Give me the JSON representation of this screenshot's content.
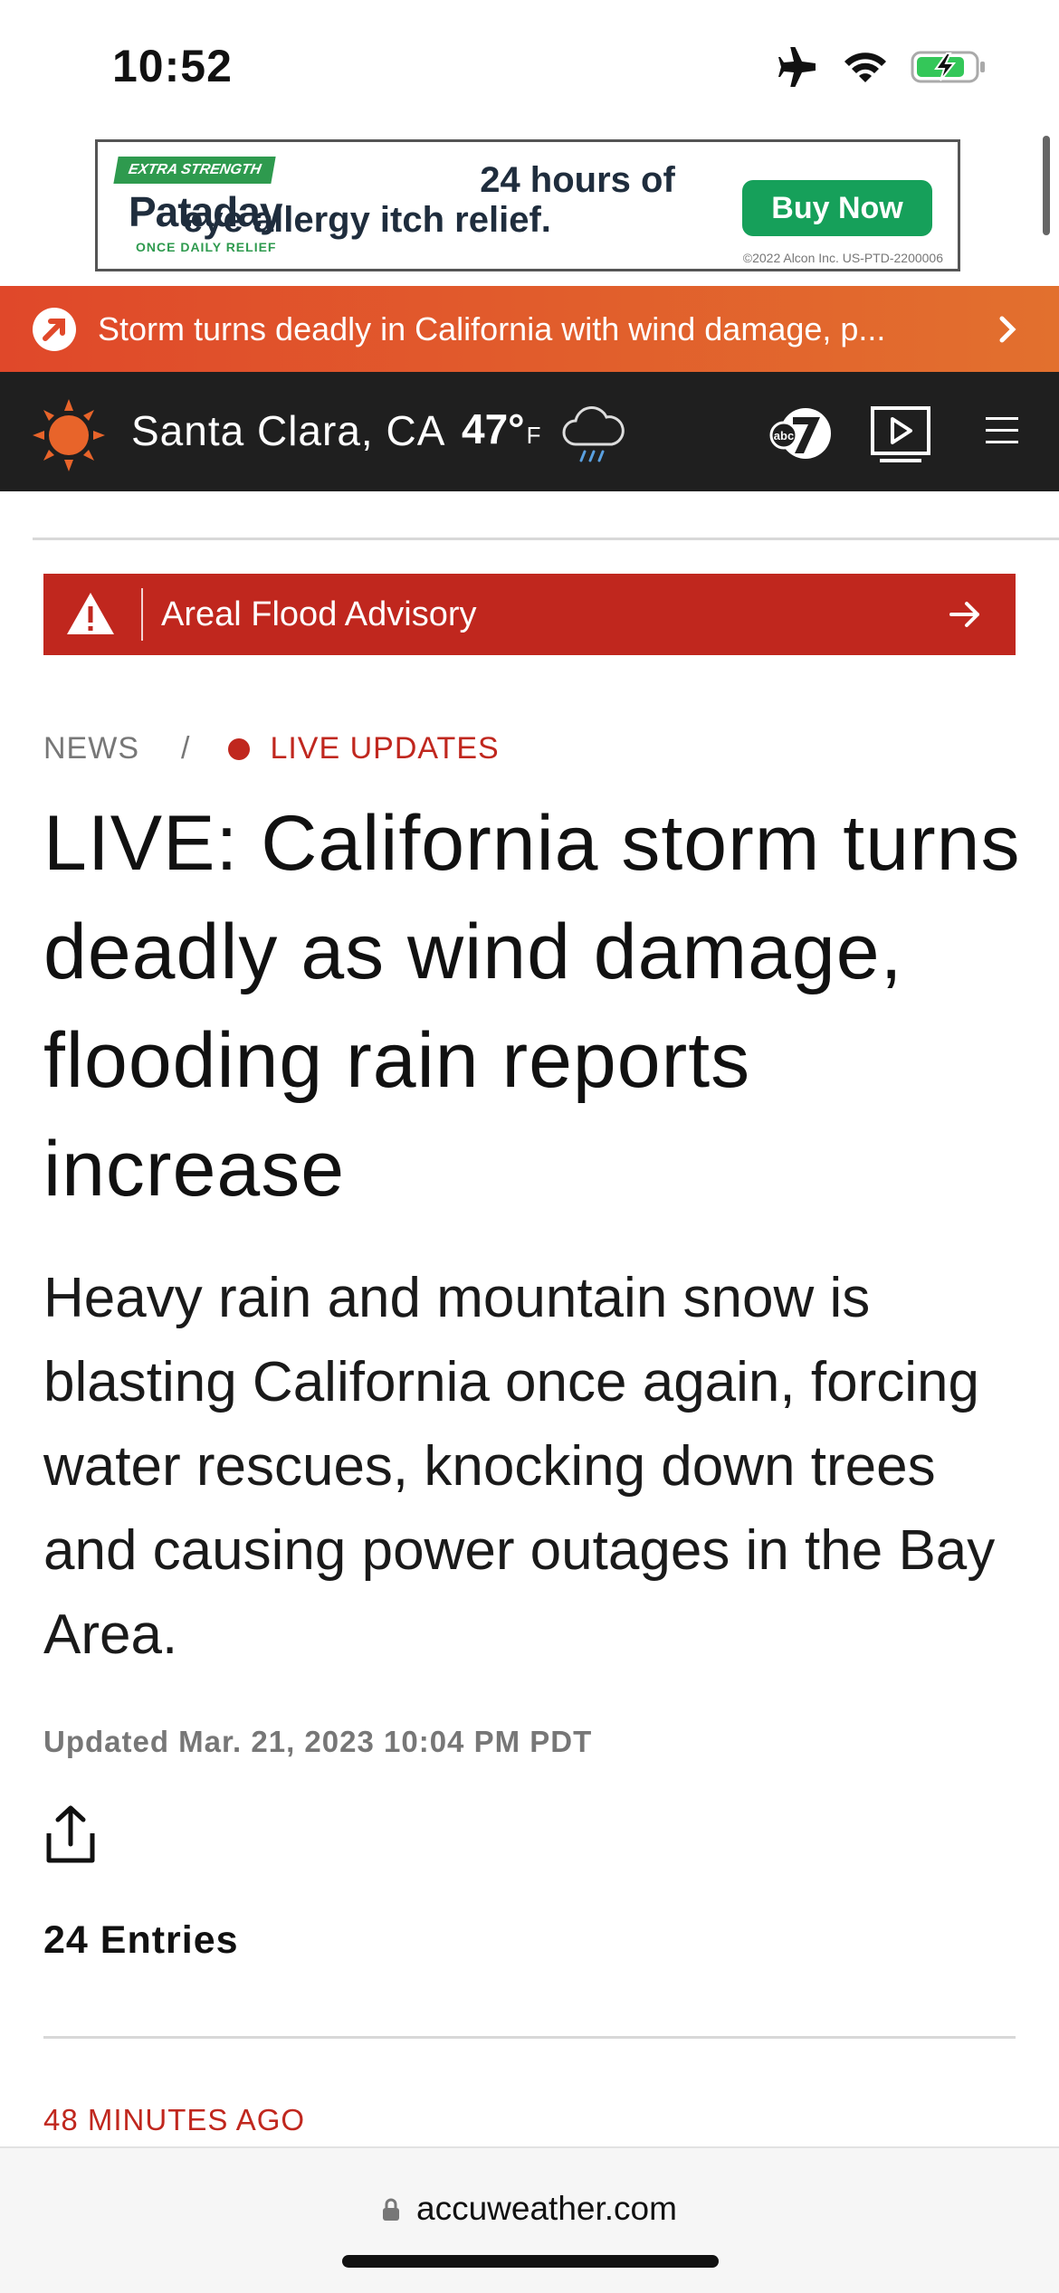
{
  "status_bar": {
    "time": "10:52",
    "icons": [
      "airplane-icon",
      "wifi-icon",
      "battery-charging-icon"
    ]
  },
  "ad": {
    "badge": "EXTRA STRENGTH",
    "brand": "Pataday",
    "brand_sub": "ONCE DAILY RELIEF",
    "headline_line1": "24 hours of",
    "headline_line2": "eye allergy itch relief.",
    "button": "Buy Now",
    "legal": "©2022 Alcon Inc.  US-PTD-2200006"
  },
  "breaking": {
    "text": "Storm turns deadly in California with wind damage, p...",
    "icon": "arrow-badge-icon"
  },
  "weather_header": {
    "location": "Santa Clara, CA",
    "temperature": "47°",
    "unit": "F",
    "condition_icon": "rain-cloud-icon",
    "partner_icon": "abc7-logo",
    "brand_color": "#e8642a"
  },
  "advisory": {
    "label": "Areal Flood Advisory",
    "color": "#c0271e"
  },
  "breadcrumb": {
    "section": "NEWS",
    "separator": "/",
    "live": "LIVE UPDATES"
  },
  "article": {
    "headline": "LIVE: California storm turns deadly as wind damage, flooding rain reports increase",
    "dek": "Heavy rain and mountain snow is blasting California once again, forcing water rescues, knocking down trees and causing power outages in the Bay Area.",
    "updated": "Updated Mar. 21, 2023 10:04 PM PDT",
    "entries": "24 Entries",
    "latest_time": "48 MINUTES AGO"
  },
  "browser": {
    "url": "accuweather.com"
  }
}
